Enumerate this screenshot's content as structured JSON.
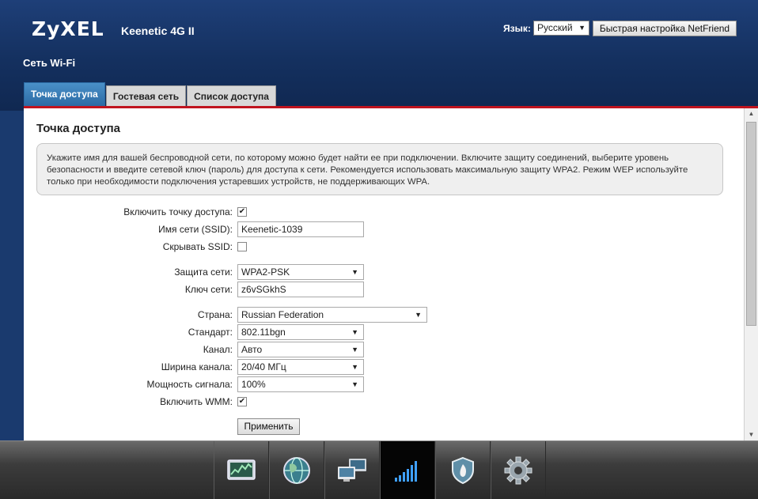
{
  "header": {
    "logo": "ZyXEL",
    "model": "Keenetic 4G II",
    "language_label": "Язык:",
    "language_value": "Русский",
    "quick_setup_label": "Быстрая настройка NetFriend"
  },
  "page_title": "Сеть Wi-Fi",
  "tabs": [
    {
      "label": "Точка доступа",
      "active": true
    },
    {
      "label": "Гостевая сеть",
      "active": false
    },
    {
      "label": "Список доступа",
      "active": false
    }
  ],
  "section": {
    "title": "Точка доступа",
    "info": "Укажите имя для вашей беспроводной сети, по которому можно будет найти ее при подключении. Включите защиту соединений, выберите уровень безопасности и введите сетевой ключ (пароль) для доступа к сети. Рекомендуется использовать максимальную защиту WPA2. Режим WEP используйте только при необходимости подключения устаревших устройств, не поддерживающих WPA."
  },
  "form": {
    "enable_ap": {
      "label": "Включить точку доступа:",
      "checked": true
    },
    "ssid": {
      "label": "Имя сети (SSID):",
      "value": "Keenetic-1039"
    },
    "hide_ssid": {
      "label": "Скрывать SSID:",
      "checked": false
    },
    "security": {
      "label": "Защита сети:",
      "value": "WPA2-PSK"
    },
    "key": {
      "label": "Ключ сети:",
      "value": "z6vSGkhS"
    },
    "country": {
      "label": "Страна:",
      "value": "Russian Federation"
    },
    "standard": {
      "label": "Стандарт:",
      "value": "802.11bgn"
    },
    "channel": {
      "label": "Канал:",
      "value": "Авто"
    },
    "bandwidth": {
      "label": "Ширина канала:",
      "value": "20/40 МГц"
    },
    "power": {
      "label": "Мощность сигнала:",
      "value": "100%"
    },
    "wmm": {
      "label": "Включить WMM:",
      "checked": true
    },
    "apply_label": "Применить"
  },
  "icons": {
    "checkmark": "✔",
    "dropdown_arrow": "▼",
    "scroll_up": "▲",
    "scroll_down": "▼"
  },
  "bottom_nav": [
    {
      "icon": "monitor-chart-icon",
      "active": false
    },
    {
      "icon": "globe-icon",
      "active": false
    },
    {
      "icon": "network-computers-icon",
      "active": false
    },
    {
      "icon": "wifi-signal-icon",
      "active": true
    },
    {
      "icon": "security-shield-icon",
      "active": false
    },
    {
      "icon": "settings-gear-icon",
      "active": false
    }
  ],
  "colors": {
    "header_bg": "#1a3a6e",
    "active_tab": "#2b6aa4",
    "accent_red": "#c0141e"
  }
}
